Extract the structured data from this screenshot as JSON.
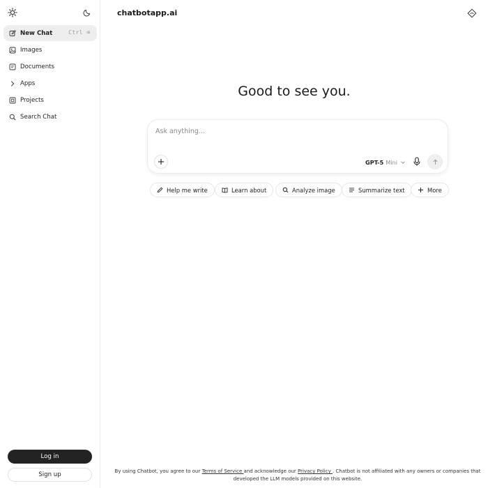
{
  "sidebar": {
    "items": [
      {
        "label": "New Chat",
        "shortcut": "Ctrl ⌫",
        "icon": "new-chat-icon"
      },
      {
        "label": "Images",
        "icon": "image-icon"
      },
      {
        "label": "Documents",
        "icon": "document-icon"
      },
      {
        "label": "Apps",
        "icon": "chevron-right-icon"
      },
      {
        "label": "Projects",
        "icon": "folder-icon"
      },
      {
        "label": "Search Chat",
        "icon": "search-icon"
      }
    ],
    "login_label": "Log in",
    "signup_label": "Sign up"
  },
  "header": {
    "brand": "chatbotapp.ai"
  },
  "main": {
    "greeting": "Good to see you.",
    "composer": {
      "placeholder": "Ask anything...",
      "model_name": "GPT-5",
      "model_variant": "Mini"
    },
    "chips": [
      {
        "label": "Help me write",
        "icon": "pencil-icon"
      },
      {
        "label": "Learn about",
        "icon": "book-icon"
      },
      {
        "label": "Analyze image",
        "icon": "search-icon"
      },
      {
        "label": "Summarize text",
        "icon": "lines-icon"
      },
      {
        "label": "More",
        "icon": "plus-icon"
      }
    ]
  },
  "footer": {
    "text_before_terms": "By using Chatbot, you agree to our ",
    "terms_label": "Terms of Service ",
    "text_middle": "and acknowledge our ",
    "privacy_label": "Privacy Policy ",
    "text_after": ". Chatbot is not affiliated with any owners or companies that developed the LLM models provided on this website."
  }
}
